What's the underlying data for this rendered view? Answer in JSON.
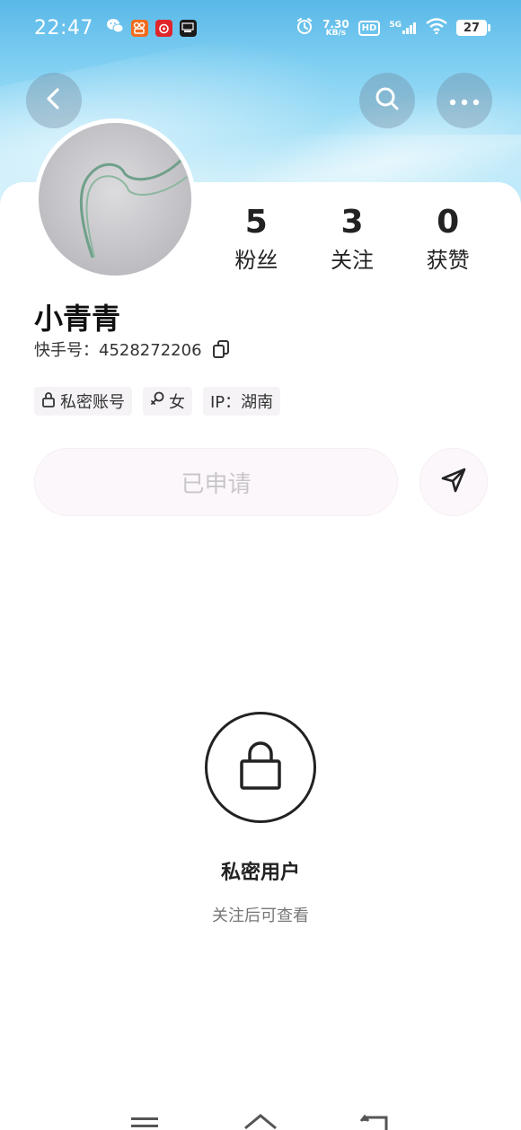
{
  "status_bar": {
    "time": "22:47",
    "net_speed_value": "7.30",
    "net_speed_unit": "KB/s",
    "hd": "HD",
    "signal": "5G",
    "battery": "27"
  },
  "profile": {
    "name": "小青青",
    "kuaishou_id_label": "快手号：",
    "kuaishou_id": "4528272206",
    "stats": [
      {
        "value": "5",
        "label": "粉丝"
      },
      {
        "value": "3",
        "label": "关注"
      },
      {
        "value": "0",
        "label": "获赞"
      }
    ],
    "tags": {
      "private": "私密账号",
      "gender": "女",
      "ip": "IP：湖南"
    },
    "apply_button": "已申请"
  },
  "private_notice": {
    "title": "私密用户",
    "subtitle": "关注后可查看"
  },
  "colors": {
    "accent_bg": "#fcf7fb",
    "disabled_text": "#c9c6c9",
    "hero_sky": "#7fcff2"
  }
}
